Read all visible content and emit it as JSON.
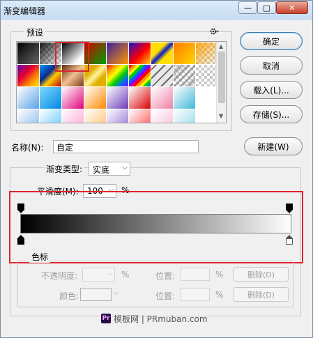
{
  "window": {
    "title": "渐变编辑器",
    "minimize": "—",
    "maximize": "□",
    "close": "✕"
  },
  "presets": {
    "legend": "预设",
    "gear_icon": "gear-icon"
  },
  "buttons": {
    "ok": "确定",
    "cancel": "取消",
    "load": "载入(L)...",
    "save": "存储(S)...",
    "new": "新建(W)"
  },
  "name_row": {
    "label": "名称(N):",
    "value": "自定"
  },
  "gradient": {
    "type_label": "渐变类型:",
    "type_value": "实底",
    "smoothness_label": "平滑度(M):",
    "smoothness_value": "100",
    "smoothness_unit": "%"
  },
  "color_stops": {
    "legend": "色标",
    "opacity_label": "不透明度:",
    "opacity_unit": "%",
    "location_label": "位置:",
    "location_unit": "%",
    "delete_label": "删除(D)",
    "color_label": "颜色:"
  },
  "watermark": {
    "badge": "Pr",
    "text": "模板网 | PRmuban.com"
  },
  "colors": {
    "highlight": "#e0242c",
    "accent": "#0078d7"
  }
}
